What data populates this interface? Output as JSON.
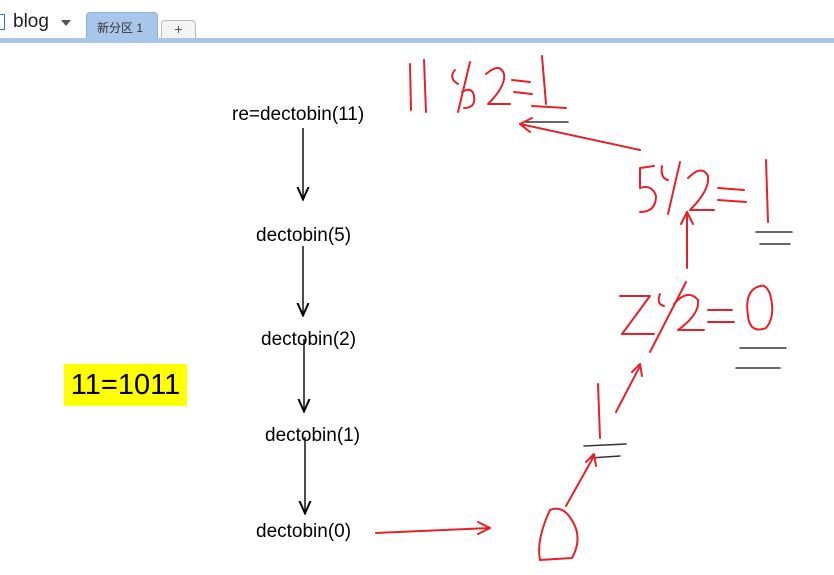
{
  "notebook": {
    "title": "blog",
    "icon": "notebook-icon"
  },
  "tabs": [
    {
      "label": "新分区 1",
      "active": true
    },
    {
      "label": "+",
      "active": false
    }
  ],
  "page": {
    "calls": [
      "re=dectobin(11)",
      "dectobin(5)",
      "dectobin(2)",
      "dectobin(1)",
      "dectobin(0)"
    ],
    "result": "11=1011",
    "handwriting": {
      "lines": [
        "11%2=1",
        "5%2=1",
        "2%2=0",
        "1",
        "0"
      ],
      "color": "#e8202a"
    },
    "highlight_color": "#ffff00",
    "accent_color": "#a9c6ea"
  }
}
